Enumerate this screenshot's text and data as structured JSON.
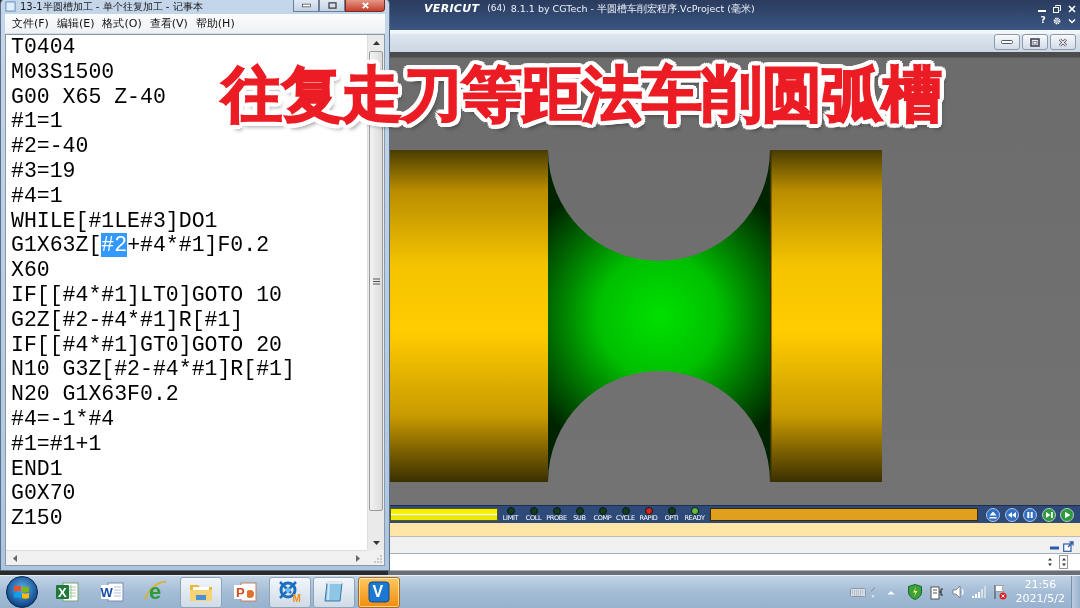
{
  "caption": {
    "text": "往复走刀等距法车削圆弧槽"
  },
  "notepad": {
    "title": "13-1半圆槽加工 - 单个往复加工 - 记事本",
    "menu": [
      "文件(F)",
      "编辑(E)",
      "格式(O)",
      "查看(V)",
      "帮助(H)"
    ],
    "lines": [
      [
        {
          "text": "T0404",
          "selected": false
        }
      ],
      [
        {
          "text": "M03S1500",
          "selected": false
        }
      ],
      [
        {
          "text": "G00 X65 Z-40",
          "selected": false
        }
      ],
      [
        {
          "text": "#1=1",
          "selected": false
        }
      ],
      [
        {
          "text": "#2=-40",
          "selected": false
        }
      ],
      [
        {
          "text": "#3=19",
          "selected": false
        }
      ],
      [
        {
          "text": "#4=1",
          "selected": false
        }
      ],
      [
        {
          "text": "WHILE[#1LE#3]DO1",
          "selected": false
        }
      ],
      [
        {
          "text": "G1X63Z[",
          "selected": false
        },
        {
          "text": "#2",
          "selected": true
        },
        {
          "text": "+#4*#1]F0.2",
          "selected": false
        }
      ],
      [
        {
          "text": "X60",
          "selected": false
        }
      ],
      [
        {
          "text": "IF[[#4*#1]LT0]GOTO 10",
          "selected": false
        }
      ],
      [
        {
          "text": "G2Z[#2-#4*#1]R[#1]",
          "selected": false
        }
      ],
      [
        {
          "text": "IF[[#4*#1]GT0]GOTO 20",
          "selected": false
        }
      ],
      [
        {
          "text": "N10 G3Z[#2-#4*#1]R[#1]",
          "selected": false
        }
      ],
      [
        {
          "text": "N20 G1X63F0.2",
          "selected": false
        }
      ],
      [
        {
          "text": "#4=-1*#4",
          "selected": false
        }
      ],
      [
        {
          "text": "#1=#1+1",
          "selected": false
        }
      ],
      [
        {
          "text": "END1",
          "selected": false
        }
      ],
      [
        {
          "text": "G0X70",
          "selected": false
        }
      ],
      [
        {
          "text": "Z150",
          "selected": false
        }
      ]
    ]
  },
  "vericut": {
    "logo": "VERICUT",
    "edition": "(64)",
    "title": "8.1.1 by CGTech - 半圆槽车削宏程序.VcProject (毫米)",
    "help": "?",
    "progress": {
      "level": 1
    },
    "indicators": [
      {
        "label": "LIMIT",
        "color": "#163c1f"
      },
      {
        "label": "COLL",
        "color": "#163c1f"
      },
      {
        "label": "PROBE",
        "color": "#163c1f"
      },
      {
        "label": "SUB",
        "color": "#163c1f"
      },
      {
        "label": "COMP",
        "color": "#163c1f"
      },
      {
        "label": "CYCLE",
        "color": "#163c1f"
      },
      {
        "label": "RAPID",
        "color": "#d8231e"
      },
      {
        "label": "OPTI",
        "color": "#163c1f"
      },
      {
        "label": "READY",
        "color": "#5cc23c"
      }
    ],
    "speed": {
      "level": 1
    }
  },
  "taskbar": {
    "apps": [
      {
        "kind": "spreadsheet",
        "glyph": "X",
        "running": false,
        "flashing": false
      },
      {
        "kind": "document",
        "glyph": "W",
        "running": false,
        "flashing": false
      },
      {
        "kind": "browser",
        "glyph": "e",
        "running": false,
        "flashing": false
      },
      {
        "kind": "folder",
        "running": true,
        "flashing": false
      },
      {
        "kind": "presentation",
        "glyph": "P",
        "running": false,
        "flashing": false
      },
      {
        "kind": "cad",
        "glyph": "M",
        "running": true,
        "flashing": false
      },
      {
        "kind": "notepad",
        "running": true,
        "flashing": false
      },
      {
        "kind": "simulator",
        "glyph": "V",
        "running": true,
        "flashing": true
      }
    ],
    "clock": {
      "time": "21:56",
      "date": "2021/5/2"
    }
  }
}
